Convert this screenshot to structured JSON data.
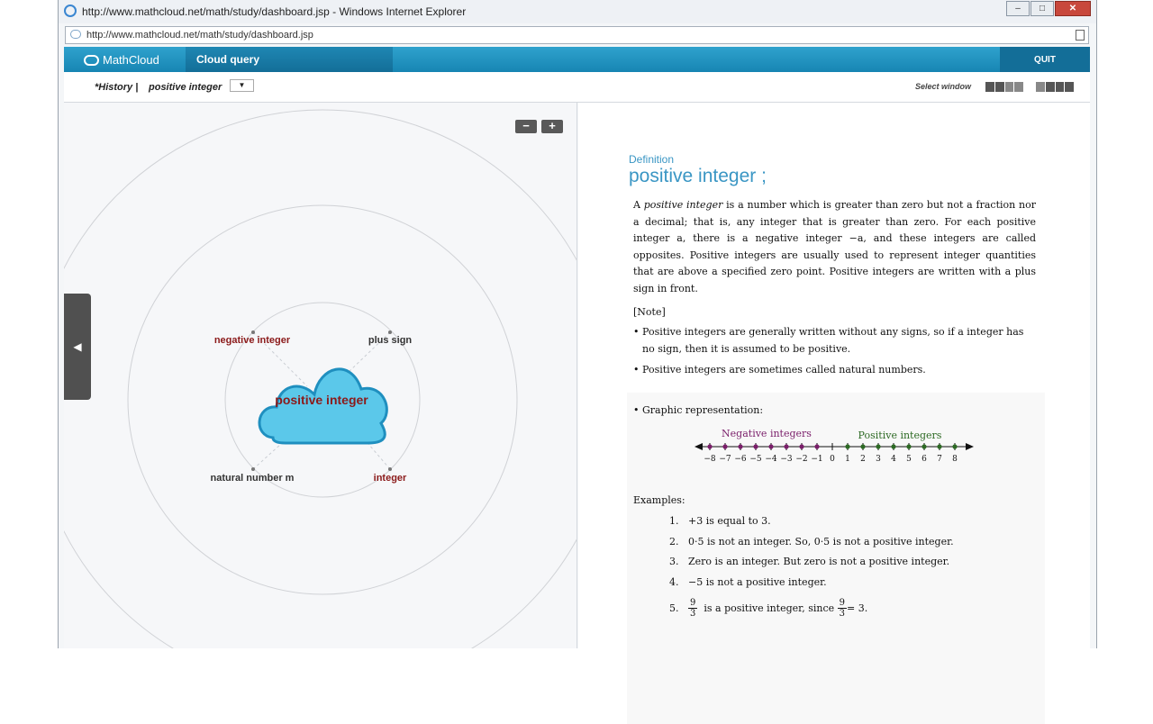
{
  "window": {
    "title": "http://www.mathcloud.net/math/study/dashboard.jsp - Windows Internet Explorer",
    "url": "http://www.mathcloud.net/math/study/dashboard.jsp"
  },
  "app": {
    "logo": "MathCloud",
    "tab": "Cloud query",
    "quit": "QUIT"
  },
  "toolbar": {
    "history_label": "*History |",
    "history_query": "positive integer",
    "select_window_label": "Select window"
  },
  "map": {
    "center": "positive integer",
    "nodes": [
      "negative integer",
      "plus sign",
      "natural number m",
      "integer"
    ]
  },
  "article": {
    "heading": "Definition",
    "title": "positive integer ;",
    "definition_term": "positive integer",
    "definition_rest": "is a number which is greater than zero but not a fraction nor a decimal; that is, any integer that is greater than zero.  For each positive integer a, there is a negative integer −a, and these integers are called opposites.  Positive integers are usually used to represent integer quantities that are above a specified zero point.  Positive integers are written with a plus sign in front.",
    "note_label": "[Note]",
    "notes": [
      "Positive integers are generally written without any signs, so if a integer has no sign, then it is assumed to be positive.",
      "Positive integers are sometimes called natural numbers."
    ],
    "graphic_label": "Graphic representation:",
    "numberline": {
      "neg_label": "Negative integers",
      "pos_label": "Positive integers",
      "ticks": [
        "−8",
        "−7",
        "−6",
        "−5",
        "−4",
        "−3",
        "−2",
        "−1",
        "0",
        "1",
        "2",
        "3",
        "4",
        "5",
        "6",
        "7",
        "8"
      ]
    },
    "examples_label": "Examples:",
    "examples": [
      {
        "n": "1.",
        "text": "+3  is equal to 3."
      },
      {
        "n": "2.",
        "text": "0·5  is not an integer.   So, 0·5  is not a positive integer."
      },
      {
        "n": "3.",
        "text": "Zero is an integer.   But zero is not a positive integer."
      },
      {
        "n": "4.",
        "text": "−5  is not a positive integer."
      }
    ],
    "example5": {
      "n": "5.",
      "frac_num": "9",
      "frac_den": "3",
      "mid": "is a positive integer, since",
      "end": "= 3."
    }
  },
  "colors": {
    "accent": "#1f8fbf",
    "neg": "#7a1e6a",
    "pos": "#2d6a24",
    "node_red": "#8b1a1a"
  }
}
